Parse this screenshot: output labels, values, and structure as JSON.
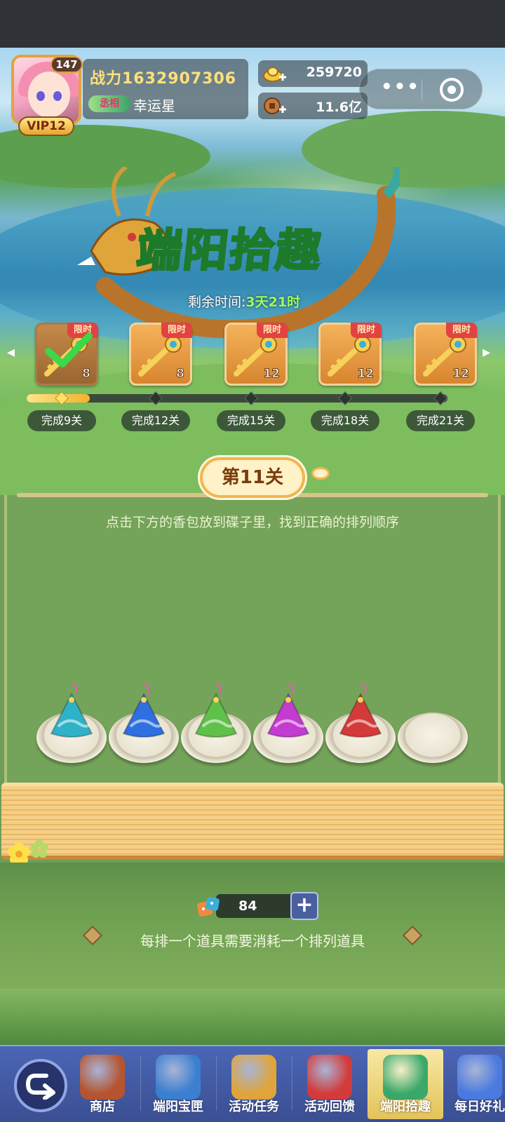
{
  "player": {
    "level": "147",
    "vip": "VIP12",
    "power": "战力1632907306",
    "rank_title": "丞相",
    "name": "幸运星"
  },
  "currencies": {
    "gold": "259720",
    "coins": "11.6亿"
  },
  "capsule": {
    "more": "•••"
  },
  "event": {
    "title_a": "端阳",
    "title_b": "拾趣",
    "time_label": "剩余时间:",
    "time_value": "3天21时"
  },
  "rewards": [
    {
      "tag": "限时",
      "count": "8",
      "claimed": true
    },
    {
      "tag": "限时",
      "count": "8",
      "claimed": false
    },
    {
      "tag": "限时",
      "count": "12",
      "claimed": false
    },
    {
      "tag": "限时",
      "count": "12",
      "claimed": false
    },
    {
      "tag": "限时",
      "count": "12",
      "claimed": false
    }
  ],
  "milestones": [
    "完成9关",
    "完成12关",
    "完成15关",
    "完成18关",
    "完成21关"
  ],
  "progress": {
    "fraction": 0.15
  },
  "puzzle": {
    "level_label": "第11关",
    "instruction": "点击下方的香包放到碟子里，找到正确的排列顺序",
    "sachet_colors": [
      "#2fb2c8",
      "#2f6fe0",
      "#5fc04a",
      "#c33bd1",
      "#d33a3a"
    ],
    "plate_count": 6
  },
  "items": {
    "count": "84",
    "plus": "+",
    "note": "每排一个道具需要消耗一个排列道具"
  },
  "nav": {
    "items": [
      {
        "label": "商店",
        "icon": "shop-icon"
      },
      {
        "label": "端阳宝匣",
        "icon": "treasure-box-icon"
      },
      {
        "label": "活动任务",
        "icon": "task-icon"
      },
      {
        "label": "活动回馈",
        "icon": "gift-icon"
      },
      {
        "label": "端阳拾趣",
        "icon": "zongzi-icon",
        "active": true
      },
      {
        "label": "每日好礼",
        "icon": "daily-gift-icon"
      }
    ]
  },
  "colors": {
    "accent_gold": "#f3b12c",
    "title_green": "#1d7a2a",
    "time_green": "#9bff5c",
    "nav_blue": "#4b66b5"
  }
}
